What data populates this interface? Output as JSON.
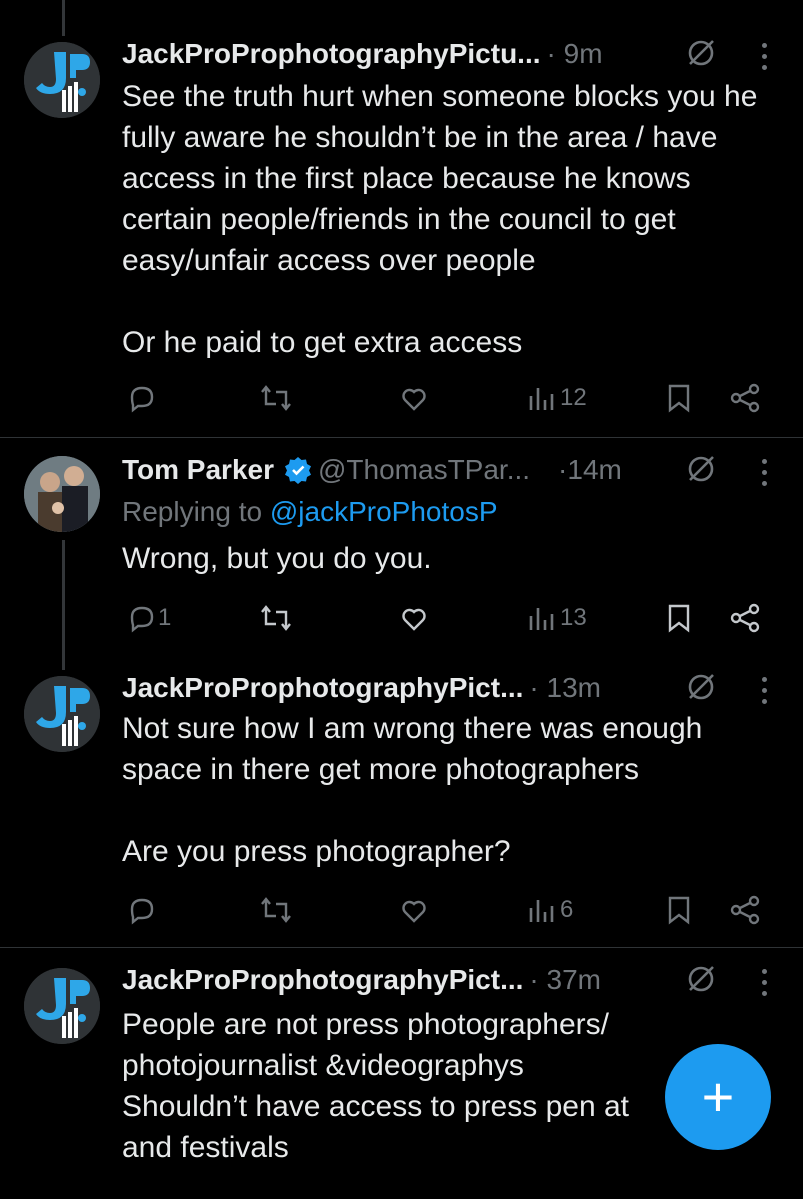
{
  "tweets": [
    {
      "name": "JackProProphotographyPictu...",
      "meta": "· 9m",
      "text": "See the truth hurt when someone blocks you he fully aware he shouldn’t be in the area / have access in the first place because he knows certain people/friends in the council to get easy/unfair access over people\n\nOr he paid to get extra access",
      "replies": "",
      "views": "12"
    },
    {
      "name": "Tom Parker",
      "handle": "@ThomasTPar...",
      "meta": "·14m",
      "reply_prefix": "Replying to ",
      "reply_handle": "@jackProPhotosP",
      "text": "Wrong, but you do you.",
      "replies": "1",
      "views": "13"
    },
    {
      "name": "JackProProphotographyPict...",
      "meta": "· 13m",
      "text": "Not sure how I am wrong there was enough space in there get more photographers\n\nAre you press photographer?",
      "replies": "",
      "views": "6"
    },
    {
      "name": "JackProProphotographyPict...",
      "meta": "· 37m",
      "text": "People are not press photographers/ photojournalist &videographys\nShouldn’t have access to press pen at\nand festivals"
    }
  ],
  "fab": {
    "label": "+"
  },
  "colors": {
    "accent": "#1d9bf0",
    "muted": "#71767b",
    "text": "#e7e9ea",
    "bg": "#000000"
  }
}
